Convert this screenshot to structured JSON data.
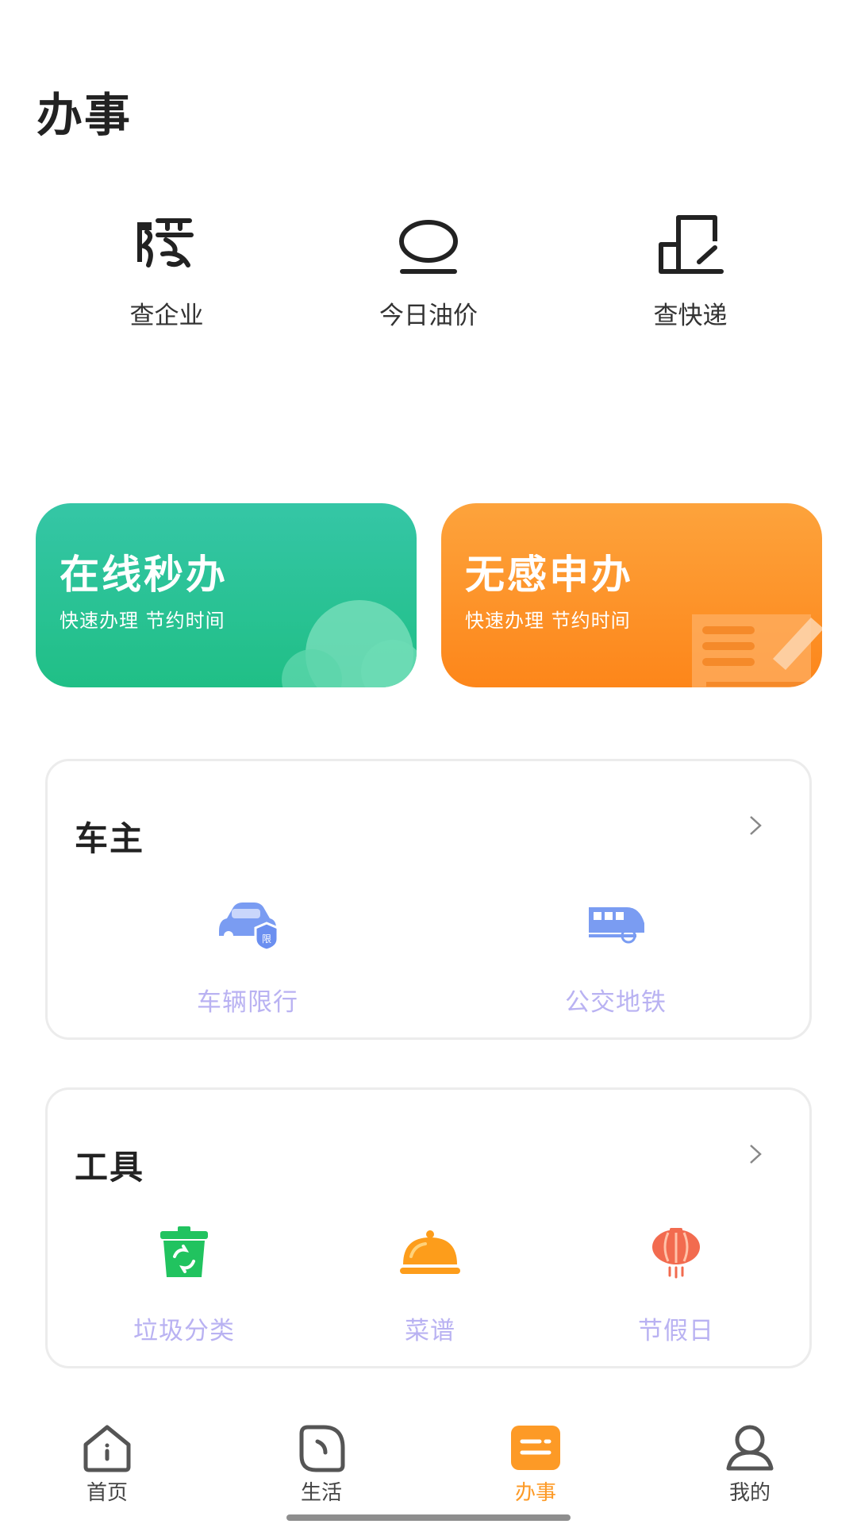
{
  "page": {
    "title": "办事"
  },
  "quick_actions": [
    {
      "label": "查企业",
      "icon": "seal-glyph-icon"
    },
    {
      "label": "今日油价",
      "icon": "oil-drop-icon"
    },
    {
      "label": "查快递",
      "icon": "package-edit-icon"
    }
  ],
  "banners": [
    {
      "title": "在线秒办",
      "subtitle": "快速办理 节约时间",
      "color": "#27c291"
    },
    {
      "title": "无感申办",
      "subtitle": "快速办理 节约时间",
      "color": "#fd9428"
    }
  ],
  "sections": {
    "owner": {
      "title": "车主",
      "items": [
        {
          "label": "车辆限行",
          "icon": "car-restriction-icon"
        },
        {
          "label": "公交地铁",
          "icon": "train-icon"
        }
      ]
    },
    "tools": {
      "title": "工具",
      "items": [
        {
          "label": "垃圾分类",
          "icon": "recycle-bin-icon"
        },
        {
          "label": "菜谱",
          "icon": "food-cloche-icon"
        },
        {
          "label": "节假日",
          "icon": "lantern-icon"
        }
      ]
    }
  },
  "tabbar": {
    "active_index": 2,
    "active_color": "#fd9a26",
    "items": [
      {
        "label": "首页",
        "icon": "home-icon"
      },
      {
        "label": "生活",
        "icon": "life-icon"
      },
      {
        "label": "办事",
        "icon": "affairs-icon"
      },
      {
        "label": "我的",
        "icon": "profile-icon"
      }
    ]
  }
}
